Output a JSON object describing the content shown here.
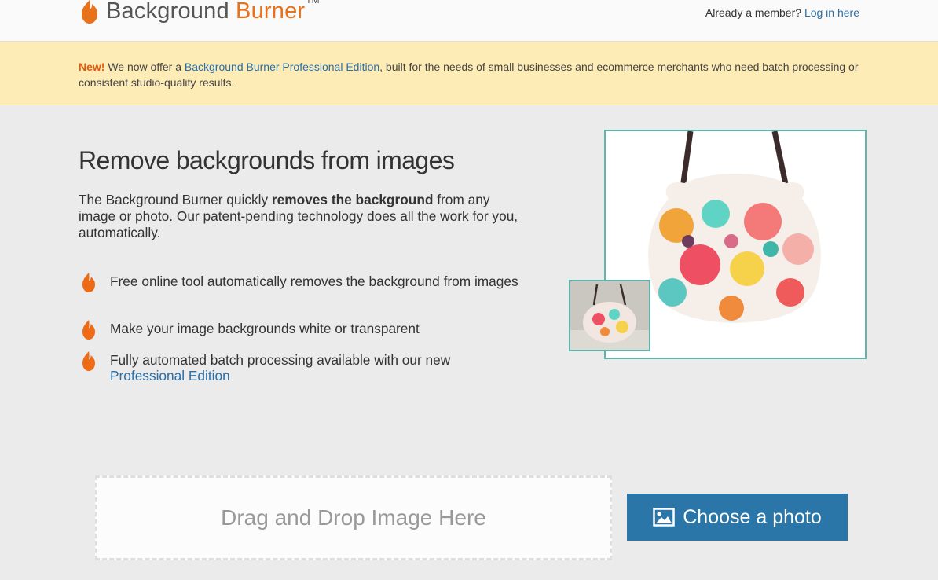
{
  "header": {
    "logo_word1": "Background",
    "logo_word2": "Burner",
    "logo_tm": "TM",
    "member_prompt": "Already a member?",
    "login_link": "Log in here"
  },
  "banner": {
    "new_label": "New!",
    "text_before": "We now offer a",
    "pro_link": "Background Burner Professional Edition",
    "text_after": ", built for the needs of small businesses and ecommerce merchants who need batch processing or consistent studio-quality results."
  },
  "main": {
    "headline": "Remove backgrounds from images",
    "intro_before": "The Background Burner quickly",
    "intro_bold": "removes the background",
    "intro_after": "from any image or photo. Our patent-pending technology does all the work for you, automatically.",
    "features": [
      "Free online tool automatically removes the background from images",
      "Make your image backgrounds white or transparent",
      "Fully automated batch processing available with our new"
    ],
    "feature3_link": "Professional Edition"
  },
  "upload": {
    "dropzone_text": "Drag and Drop Image Here",
    "choose_button": "Choose a photo"
  },
  "colors": {
    "accent_orange": "#e8721c",
    "link_blue": "#2a6ea6",
    "button_blue": "#2a76a8",
    "banner_yellow": "#fdecb6",
    "frame_teal": "#5fb5aa"
  },
  "icons": {
    "logo": "flame-icon",
    "bullet": "flame-bullet-icon",
    "button": "image-icon"
  }
}
